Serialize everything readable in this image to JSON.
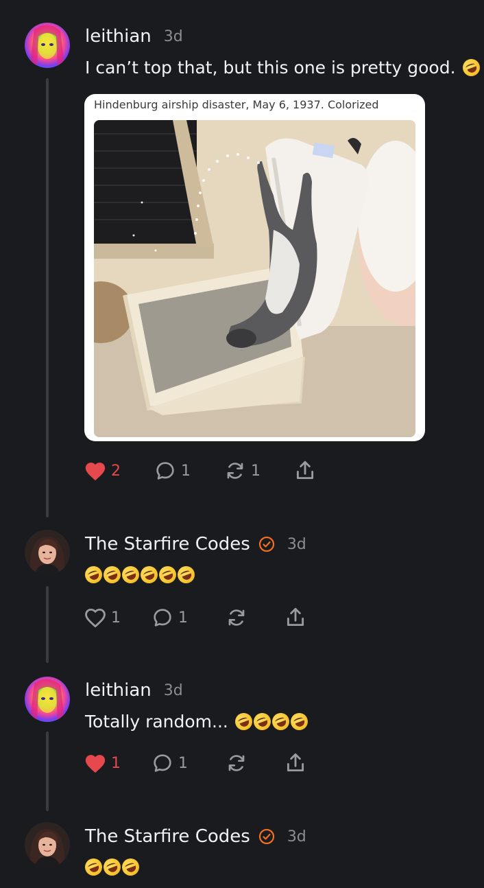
{
  "posts": [
    {
      "username": "leithian",
      "time": "3d",
      "text": "I can’t top that, but this one is pretty good.",
      "emoji_count": 1,
      "quote": {
        "caption": "Hindenburg airship disaster, May 6, 1937. Colorized",
        "image_alt": "cat in litter box peeing over tipped-over lid"
      },
      "likes": "2",
      "comments": "1",
      "restacks": "1",
      "liked": true
    },
    {
      "username": "The Starfire Codes",
      "verified": true,
      "time": "3d",
      "text": "",
      "emoji_count": 6,
      "likes": "1",
      "comments": "1",
      "restacks": "",
      "liked": false
    },
    {
      "username": "leithian",
      "time": "3d",
      "text": "Totally random...",
      "emoji_count": 4,
      "likes": "1",
      "comments": "1",
      "restacks": "",
      "liked": true
    },
    {
      "username": "The Starfire Codes",
      "verified": true,
      "time": "3d",
      "text": "",
      "emoji_count": 3
    }
  ],
  "colors": {
    "background": "#1a1b1e",
    "like_red": "#e5484d",
    "verified_orange": "#f36f21",
    "muted": "#9a9ba0"
  },
  "icons": [
    "heart-icon",
    "comment-icon",
    "restack-icon",
    "share-icon",
    "verified-icon",
    "rofl-emoji"
  ]
}
